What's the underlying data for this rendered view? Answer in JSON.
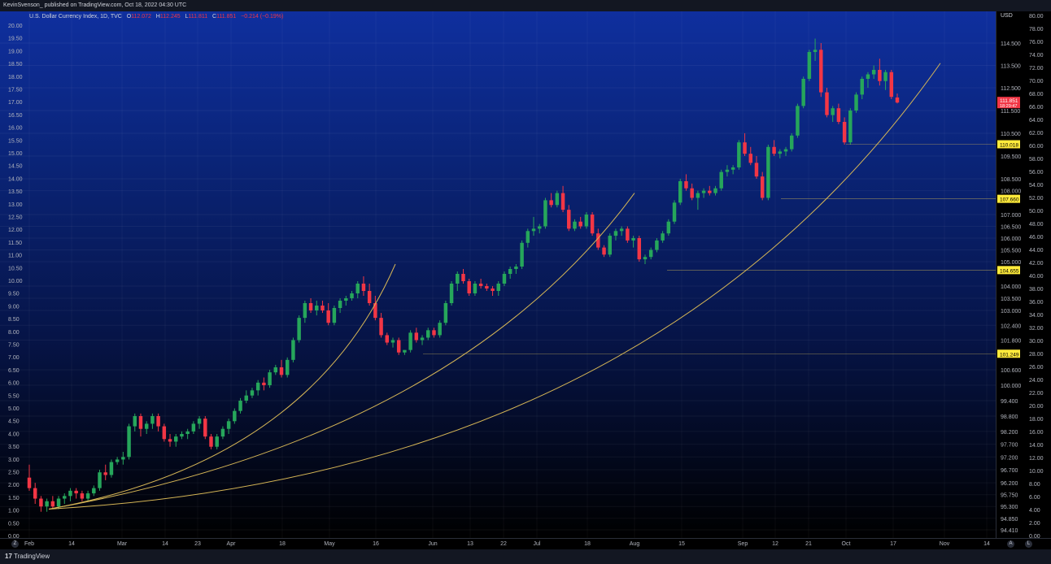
{
  "header": {
    "publisher": "KevinSvenson_ published on TradingView.com, Oct 18, 2022 04:30 UTC"
  },
  "legend": {
    "symbol": "U.S. Dollar Currency Index, 1D, TVC",
    "o_label": "O",
    "o_value": "112.072",
    "h_label": "H",
    "h_value": "112.245",
    "l_label": "L",
    "l_value": "111.811",
    "c_label": "C",
    "c_value": "111.851",
    "change": "−0.214 (−0.19%)"
  },
  "currency": "USD",
  "footer": {
    "brand": "TradingView"
  },
  "colors": {
    "up": "#26a65b",
    "down": "#f23645",
    "fit_line": "#d6b656",
    "level_line": "#c9b458",
    "level_badge": "#ffeb3b",
    "price_badge": "#f23645"
  },
  "chart_data": {
    "type": "candlestick",
    "right_axis_ticks": [
      "114.500",
      "113.500",
      "112.500",
      "111.500",
      "110.500",
      "109.500",
      "108.500",
      "108.000",
      "107.000",
      "106.500",
      "106.000",
      "105.500",
      "105.000",
      "104.000",
      "103.500",
      "103.000",
      "102.400",
      "101.800",
      "100.600",
      "100.000",
      "99.400",
      "98.800",
      "98.200",
      "97.700",
      "97.200",
      "96.700",
      "96.200",
      "95.750",
      "95.300",
      "94.850",
      "94.410"
    ],
    "right_axis_ticks_y": [
      114.5,
      113.5,
      112.5,
      111.5,
      110.5,
      109.5,
      108.5,
      108.0,
      107.0,
      106.5,
      106.0,
      105.5,
      105.0,
      104.0,
      103.5,
      103.0,
      102.4,
      101.8,
      100.6,
      100.0,
      99.4,
      98.8,
      98.2,
      97.7,
      97.2,
      96.7,
      96.2,
      95.75,
      95.3,
      94.85,
      94.41
    ],
    "outer_right_ticks": [
      "80.00",
      "78.00",
      "76.00",
      "74.00",
      "72.00",
      "70.00",
      "68.00",
      "66.00",
      "64.00",
      "62.00",
      "60.00",
      "58.00",
      "56.00",
      "54.00",
      "52.00",
      "50.00",
      "48.00",
      "46.00",
      "44.00",
      "42.00",
      "40.00",
      "38.00",
      "36.00",
      "34.00",
      "32.00",
      "30.00",
      "28.00",
      "26.00",
      "24.00",
      "22.00",
      "20.00",
      "18.00",
      "16.00",
      "14.00",
      "12.00",
      "10.00",
      "8.00",
      "6.00",
      "4.00",
      "2.00",
      "0.00"
    ],
    "left_axis_ticks": [
      "20.00",
      "19.50",
      "19.00",
      "18.50",
      "18.00",
      "17.50",
      "17.00",
      "16.50",
      "16.00",
      "15.50",
      "15.00",
      "14.50",
      "14.00",
      "13.50",
      "13.00",
      "12.50",
      "12.00",
      "11.50",
      "11.00",
      "10.50",
      "10.00",
      "9.50",
      "9.00",
      "8.50",
      "8.00",
      "7.50",
      "7.00",
      "6.50",
      "6.00",
      "5.50",
      "5.00",
      "4.50",
      "4.00",
      "3.50",
      "3.00",
      "2.50",
      "2.00",
      "1.50",
      "1.00",
      "0.50",
      "0.00"
    ],
    "x_axis_ticks": [
      "Feb",
      "14",
      "Mar",
      "14",
      "23",
      "Apr",
      "18",
      "May",
      "16",
      "Jun",
      "13",
      "22",
      "Jul",
      "18",
      "Aug",
      "15",
      "Sep",
      "12",
      "21",
      "Oct",
      "17",
      "Nov",
      "14"
    ],
    "price_levels": [
      {
        "label": "110.018",
        "value": 110.018
      },
      {
        "label": "107.660",
        "value": 107.66
      },
      {
        "label": "104.655",
        "value": 104.655
      },
      {
        "label": "101.249",
        "value": 101.249
      }
    ],
    "current_price": {
      "label": "111.851",
      "countdown": "18:29:47",
      "value": 111.851
    },
    "candles": [
      [
        96.4,
        96.9,
        95.9,
        96.0
      ],
      [
        96.0,
        96.2,
        95.4,
        95.6
      ],
      [
        95.6,
        95.7,
        95.1,
        95.3
      ],
      [
        95.3,
        95.6,
        95.1,
        95.5
      ],
      [
        95.5,
        95.7,
        95.2,
        95.3
      ],
      [
        95.3,
        95.7,
        95.2,
        95.6
      ],
      [
        95.6,
        95.8,
        95.4,
        95.7
      ],
      [
        95.7,
        96.0,
        95.5,
        95.9
      ],
      [
        95.9,
        96.0,
        95.6,
        95.8
      ],
      [
        95.8,
        95.9,
        95.5,
        95.6
      ],
      [
        95.6,
        95.9,
        95.5,
        95.8
      ],
      [
        95.8,
        96.1,
        95.7,
        96.0
      ],
      [
        96.0,
        96.7,
        95.9,
        96.6
      ],
      [
        96.6,
        96.9,
        96.3,
        96.5
      ],
      [
        96.5,
        97.1,
        96.4,
        97.0
      ],
      [
        97.0,
        97.2,
        96.9,
        97.1
      ],
      [
        97.1,
        97.4,
        96.9,
        97.2
      ],
      [
        97.2,
        98.5,
        97.1,
        98.4
      ],
      [
        98.4,
        98.9,
        98.2,
        98.8
      ],
      [
        98.8,
        98.9,
        98.0,
        98.3
      ],
      [
        98.3,
        98.6,
        98.1,
        98.5
      ],
      [
        98.5,
        98.9,
        98.3,
        98.8
      ],
      [
        98.8,
        98.9,
        98.2,
        98.4
      ],
      [
        98.4,
        98.5,
        97.8,
        97.9
      ],
      [
        97.9,
        98.1,
        97.6,
        97.8
      ],
      [
        97.8,
        98.1,
        97.6,
        98.0
      ],
      [
        98.0,
        98.2,
        97.9,
        98.1
      ],
      [
        98.1,
        98.3,
        97.9,
        98.2
      ],
      [
        98.2,
        98.6,
        98.1,
        98.5
      ],
      [
        98.5,
        98.8,
        98.3,
        98.7
      ],
      [
        98.7,
        98.8,
        97.9,
        98.0
      ],
      [
        98.0,
        98.1,
        97.5,
        97.6
      ],
      [
        97.6,
        98.1,
        97.5,
        98.0
      ],
      [
        98.0,
        98.4,
        97.9,
        98.3
      ],
      [
        98.3,
        98.7,
        98.1,
        98.6
      ],
      [
        98.6,
        99.1,
        98.5,
        99.0
      ],
      [
        99.0,
        99.5,
        98.9,
        99.4
      ],
      [
        99.4,
        99.8,
        99.3,
        99.6
      ],
      [
        99.6,
        99.9,
        99.5,
        99.8
      ],
      [
        99.8,
        100.2,
        99.6,
        100.1
      ],
      [
        100.1,
        100.3,
        99.8,
        100.0
      ],
      [
        100.0,
        100.6,
        99.9,
        100.5
      ],
      [
        100.5,
        100.8,
        100.4,
        100.7
      ],
      [
        100.7,
        101.0,
        100.3,
        100.4
      ],
      [
        100.4,
        101.1,
        100.3,
        101.0
      ],
      [
        101.0,
        101.9,
        100.9,
        101.8
      ],
      [
        101.8,
        102.8,
        101.7,
        102.7
      ],
      [
        102.7,
        103.4,
        102.5,
        103.3
      ],
      [
        103.3,
        103.5,
        102.9,
        103.0
      ],
      [
        103.0,
        103.4,
        102.8,
        103.2
      ],
      [
        103.2,
        103.4,
        102.9,
        103.0
      ],
      [
        103.0,
        103.3,
        102.4,
        102.5
      ],
      [
        102.5,
        103.2,
        102.4,
        103.1
      ],
      [
        103.1,
        103.5,
        102.9,
        103.4
      ],
      [
        103.4,
        103.6,
        103.2,
        103.5
      ],
      [
        103.5,
        103.8,
        103.4,
        103.7
      ],
      [
        103.7,
        104.2,
        103.5,
        104.1
      ],
      [
        104.1,
        104.4,
        103.6,
        103.8
      ],
      [
        103.8,
        104.1,
        103.2,
        103.3
      ],
      [
        103.3,
        103.6,
        102.6,
        102.7
      ],
      [
        102.7,
        102.9,
        101.9,
        102.0
      ],
      [
        102.0,
        102.1,
        101.6,
        101.7
      ],
      [
        101.7,
        101.9,
        101.5,
        101.8
      ],
      [
        101.8,
        101.9,
        101.2,
        101.3
      ],
      [
        101.3,
        101.4,
        101.2,
        101.4
      ],
      [
        101.4,
        102.2,
        101.3,
        102.1
      ],
      [
        102.1,
        102.3,
        101.7,
        101.8
      ],
      [
        101.8,
        102.0,
        101.6,
        101.9
      ],
      [
        101.9,
        102.3,
        101.8,
        102.2
      ],
      [
        102.2,
        102.3,
        101.9,
        102.0
      ],
      [
        102.0,
        102.6,
        101.9,
        102.5
      ],
      [
        102.5,
        103.4,
        102.4,
        103.3
      ],
      [
        103.3,
        104.2,
        103.2,
        104.1
      ],
      [
        104.1,
        104.6,
        103.8,
        104.5
      ],
      [
        104.5,
        104.7,
        104.1,
        104.2
      ],
      [
        104.2,
        104.3,
        103.6,
        103.7
      ],
      [
        103.7,
        104.2,
        103.6,
        104.1
      ],
      [
        104.1,
        104.3,
        103.9,
        104.0
      ],
      [
        104.0,
        104.1,
        103.8,
        103.9
      ],
      [
        103.9,
        104.0,
        103.6,
        103.8
      ],
      [
        103.8,
        104.2,
        103.6,
        104.1
      ],
      [
        104.1,
        104.6,
        104.0,
        104.5
      ],
      [
        104.5,
        104.8,
        104.3,
        104.7
      ],
      [
        104.7,
        104.9,
        104.5,
        104.8
      ],
      [
        104.8,
        105.9,
        104.7,
        105.8
      ],
      [
        105.8,
        106.4,
        105.6,
        106.3
      ],
      [
        106.3,
        106.9,
        106.1,
        106.4
      ],
      [
        106.4,
        106.6,
        106.2,
        106.5
      ],
      [
        106.5,
        107.7,
        106.4,
        107.6
      ],
      [
        107.6,
        107.9,
        107.3,
        107.4
      ],
      [
        107.4,
        108.0,
        107.3,
        107.9
      ],
      [
        107.9,
        108.2,
        107.1,
        107.2
      ],
      [
        107.2,
        107.4,
        106.3,
        106.4
      ],
      [
        106.4,
        106.8,
        106.3,
        106.7
      ],
      [
        106.7,
        106.9,
        106.4,
        106.5
      ],
      [
        106.5,
        107.1,
        106.4,
        107.0
      ],
      [
        107.0,
        107.1,
        106.1,
        106.2
      ],
      [
        106.2,
        106.4,
        105.5,
        105.6
      ],
      [
        105.6,
        105.7,
        105.2,
        105.3
      ],
      [
        105.3,
        106.2,
        105.2,
        106.1
      ],
      [
        106.1,
        106.4,
        105.9,
        106.3
      ],
      [
        106.3,
        106.5,
        106.1,
        106.4
      ],
      [
        106.4,
        106.5,
        105.8,
        105.9
      ],
      [
        105.9,
        106.1,
        105.6,
        106.0
      ],
      [
        106.0,
        106.1,
        105.0,
        105.1
      ],
      [
        105.1,
        105.3,
        104.9,
        105.2
      ],
      [
        105.2,
        105.6,
        105.1,
        105.5
      ],
      [
        105.5,
        106.0,
        105.4,
        105.9
      ],
      [
        105.9,
        106.3,
        105.8,
        106.2
      ],
      [
        106.2,
        106.8,
        106.1,
        106.7
      ],
      [
        106.7,
        107.6,
        106.6,
        107.5
      ],
      [
        107.5,
        108.5,
        107.4,
        108.4
      ],
      [
        108.4,
        108.7,
        108.0,
        108.1
      ],
      [
        108.1,
        108.3,
        107.6,
        107.7
      ],
      [
        107.7,
        108.0,
        107.2,
        107.9
      ],
      [
        107.9,
        108.1,
        107.7,
        108.0
      ],
      [
        108.0,
        108.2,
        107.8,
        107.9
      ],
      [
        107.9,
        108.2,
        107.8,
        108.1
      ],
      [
        108.1,
        108.9,
        108.0,
        108.8
      ],
      [
        108.8,
        109.1,
        108.6,
        108.9
      ],
      [
        108.9,
        109.1,
        108.7,
        109.0
      ],
      [
        109.0,
        110.2,
        108.9,
        110.1
      ],
      [
        110.1,
        110.5,
        109.5,
        109.6
      ],
      [
        109.6,
        109.9,
        109.1,
        109.2
      ],
      [
        109.2,
        109.5,
        108.5,
        108.6
      ],
      [
        108.6,
        108.8,
        107.6,
        107.7
      ],
      [
        107.7,
        110.0,
        107.6,
        109.9
      ],
      [
        109.9,
        110.2,
        109.5,
        109.6
      ],
      [
        109.6,
        109.8,
        109.4,
        109.7
      ],
      [
        109.7,
        109.9,
        109.5,
        109.8
      ],
      [
        109.8,
        110.5,
        109.7,
        110.4
      ],
      [
        110.4,
        111.8,
        110.3,
        111.7
      ],
      [
        111.7,
        113.0,
        111.6,
        112.9
      ],
      [
        112.9,
        114.2,
        112.8,
        114.1
      ],
      [
        114.1,
        114.7,
        113.7,
        114.2
      ],
      [
        114.2,
        114.5,
        112.1,
        112.3
      ],
      [
        112.3,
        112.5,
        111.2,
        111.3
      ],
      [
        111.3,
        111.7,
        111.0,
        111.6
      ],
      [
        111.6,
        111.8,
        110.9,
        111.0
      ],
      [
        111.0,
        111.2,
        110.0,
        110.1
      ],
      [
        110.1,
        111.6,
        110.0,
        111.5
      ],
      [
        111.5,
        112.3,
        111.4,
        112.2
      ],
      [
        112.2,
        113.0,
        112.0,
        112.9
      ],
      [
        112.9,
        113.2,
        112.5,
        113.1
      ],
      [
        113.1,
        113.5,
        112.9,
        113.3
      ],
      [
        113.3,
        113.8,
        112.6,
        112.8
      ],
      [
        112.8,
        113.3,
        112.4,
        113.2
      ],
      [
        113.2,
        113.3,
        112.0,
        112.1
      ],
      [
        112.072,
        112.245,
        111.811,
        111.851
      ]
    ],
    "fit_curves": [
      "parabolic support 1",
      "parabolic support 2",
      "parabolic support 3"
    ]
  }
}
